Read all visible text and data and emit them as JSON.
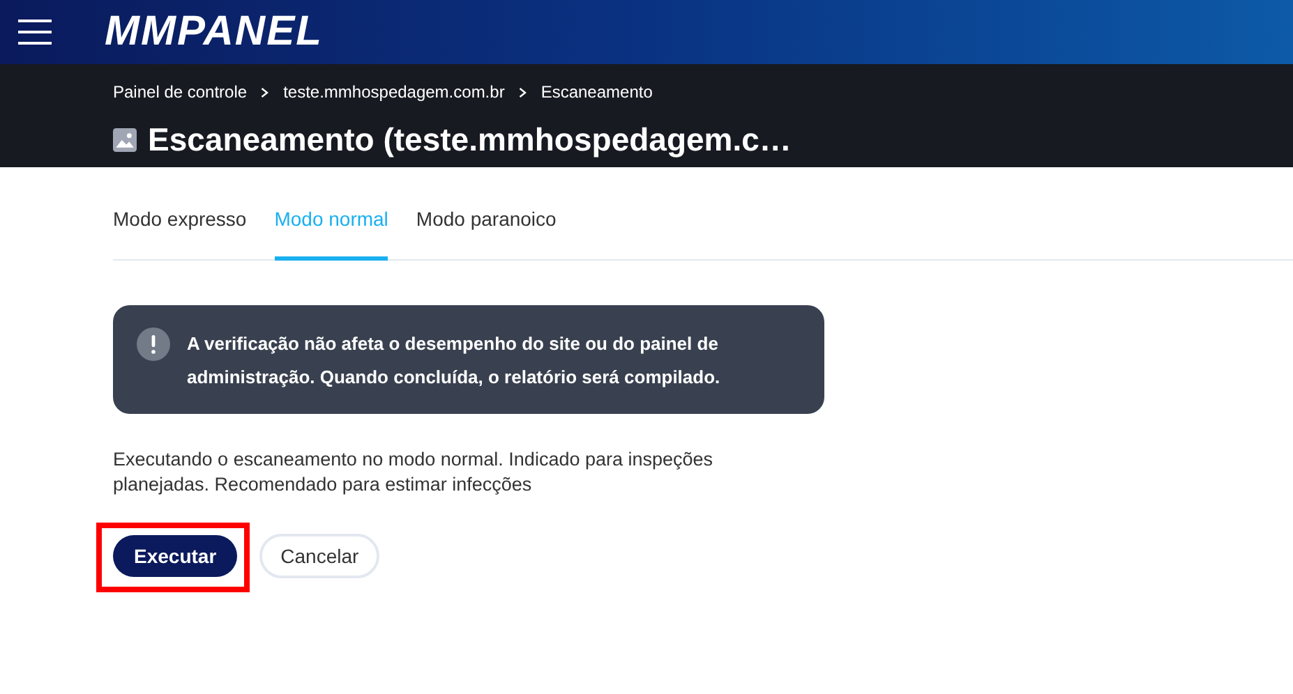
{
  "header": {
    "logo": "MMPANEL"
  },
  "breadcrumbs": [
    "Painel de controle",
    "teste.mmhospedagem.com.br",
    "Escaneamento"
  ],
  "page_title": "Escaneamento (teste.mmhospedagem.c…",
  "tabs": [
    {
      "label": "Modo expresso",
      "selected": false
    },
    {
      "label": "Modo normal",
      "selected": true
    },
    {
      "label": "Modo paranoico",
      "selected": false
    }
  ],
  "alert": {
    "text": "A verificação não afeta o desempenho do site ou do painel de administração. Quando concluída, o relatório será compilado."
  },
  "description": "Executando o escaneamento no modo normal. Indicado para inspeções planejadas. Recomendado para estimar infecções",
  "buttons": [
    {
      "label": "Executar",
      "kind": "primary",
      "highlighted": true
    },
    {
      "label": "Cancelar",
      "kind": "secondary",
      "highlighted": false
    }
  ]
}
